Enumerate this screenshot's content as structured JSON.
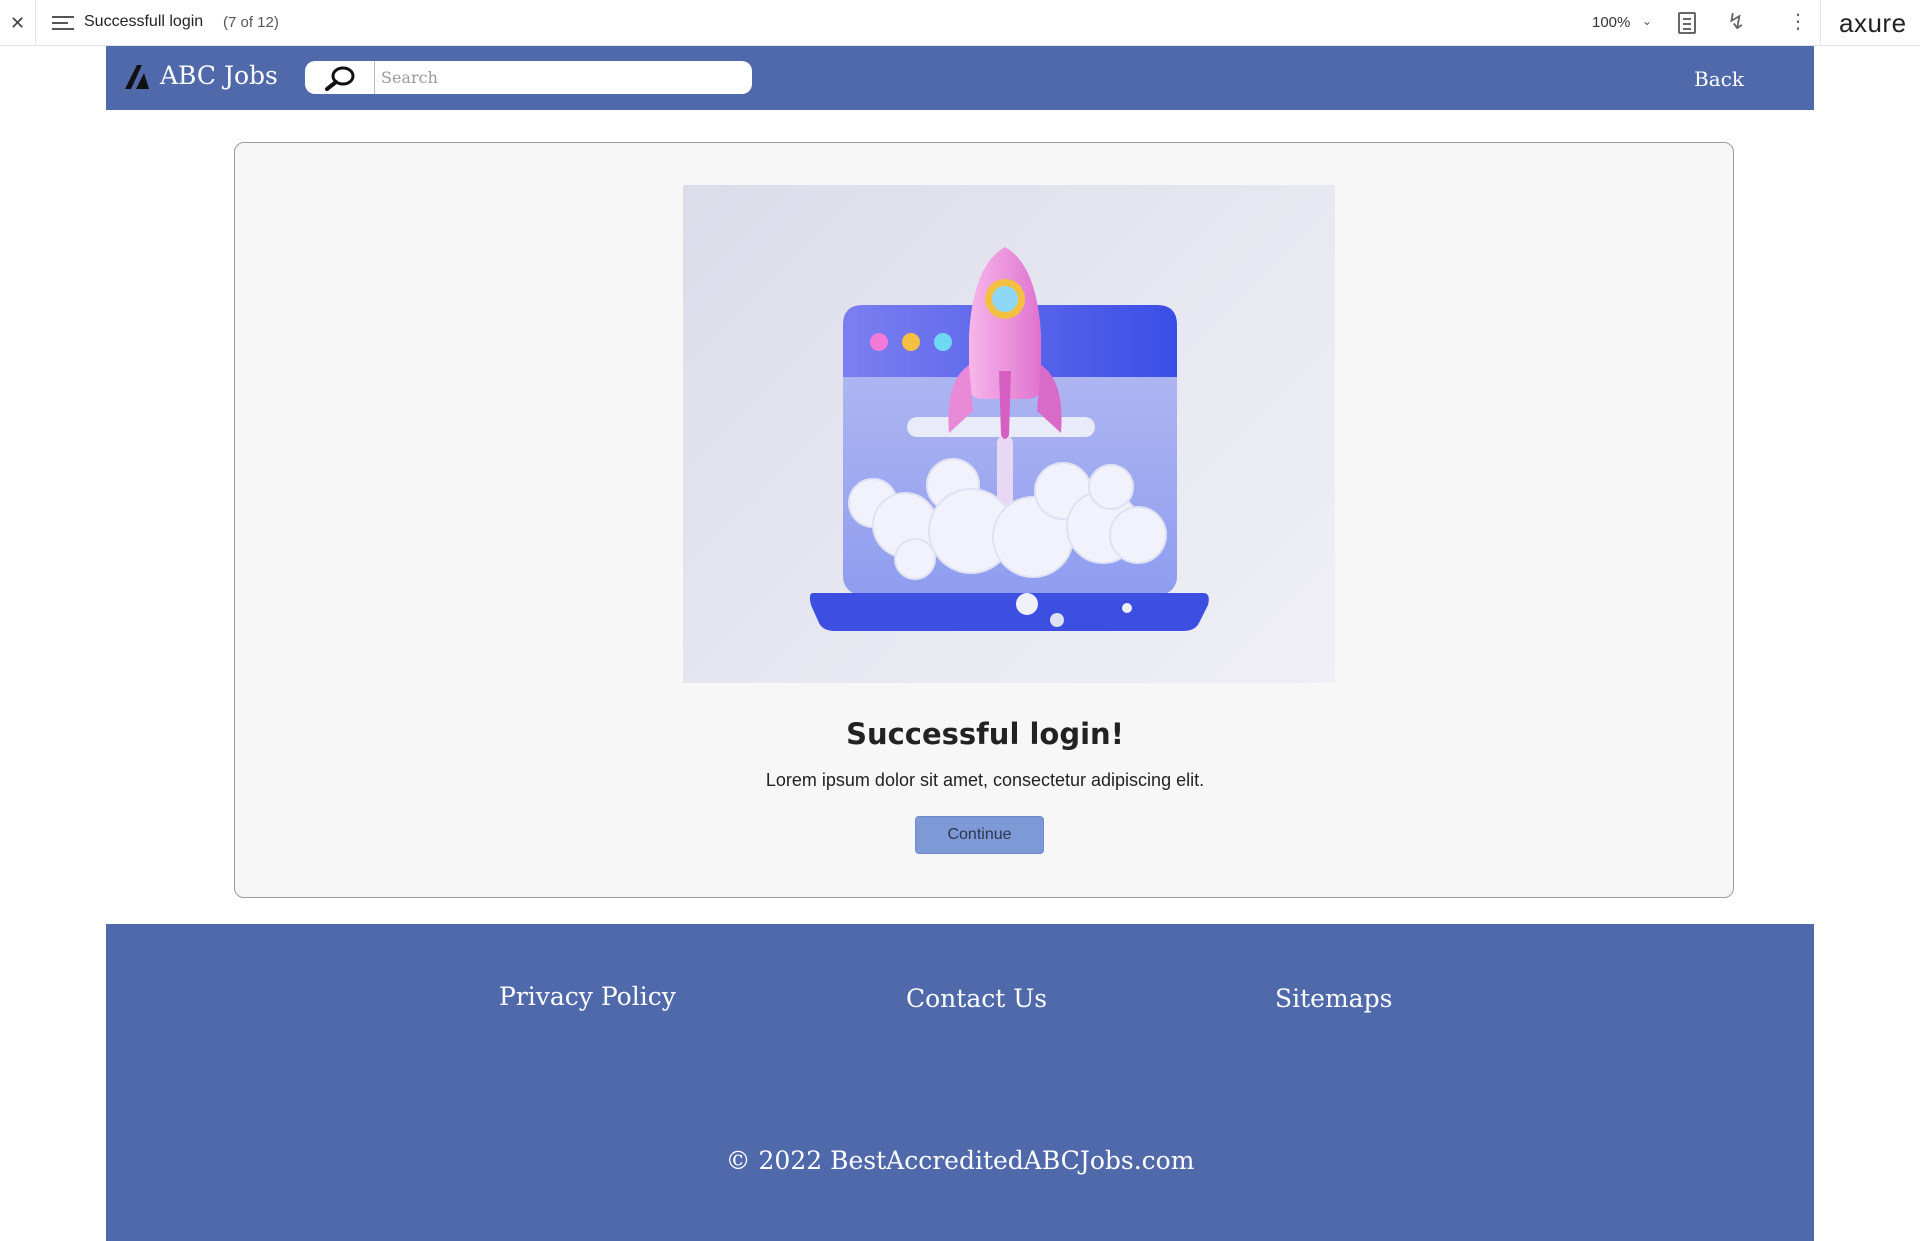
{
  "axure": {
    "close_glyph": "✕",
    "page_title": "Successfull login",
    "page_count": "(7 of 12)",
    "zoom": "100%",
    "logo": "axure",
    "icons": [
      "close-icon",
      "menu-icon",
      "chevron-down-icon",
      "notes-icon",
      "interactions-icon",
      "more-icon"
    ]
  },
  "header": {
    "brand": "ABC Jobs",
    "search_placeholder": "Search",
    "back_label": "Back",
    "colors": {
      "bar": "#5069ab",
      "text": "#ffffff"
    }
  },
  "card": {
    "image": "rocket-launch-illustration",
    "title": "Successful login!",
    "text": "Lorem ipsum dolor sit amet, consectetur adipiscing elit.",
    "button_label": "Continue",
    "colors": {
      "button": "#7d9ad6"
    }
  },
  "footer": {
    "links": [
      "Privacy Policy",
      "Contact Us",
      "Sitemaps"
    ],
    "copyright": "© 2022 BestAccreditedABCJobs.com"
  }
}
